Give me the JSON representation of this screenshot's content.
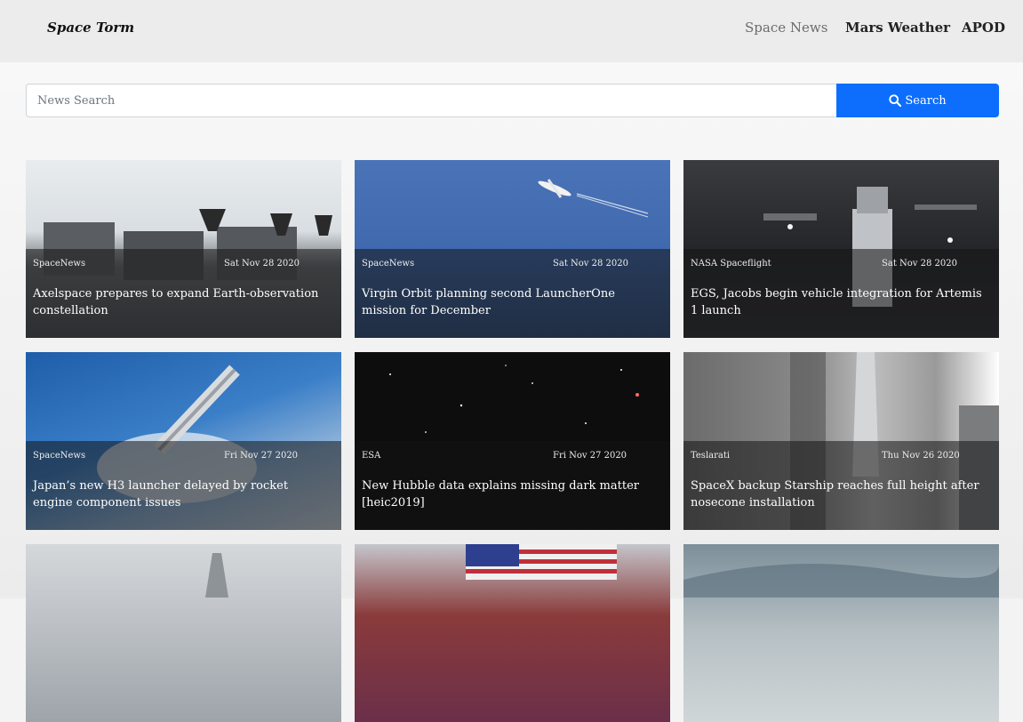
{
  "navbar": {
    "brand": "Space Torm",
    "links": [
      {
        "label": "Space News",
        "active": true
      },
      {
        "label": "Mars Weather",
        "active": false
      },
      {
        "label": "APOD",
        "active": false
      }
    ]
  },
  "search": {
    "placeholder": "News Search",
    "value": "",
    "button_label": "Search",
    "button_color": "#0d6efd"
  },
  "articles": [
    {
      "source": "SpaceNews",
      "date": "Sat Nov 28 2020",
      "title": "Axelspace prepares to expand Earth-observation constellation"
    },
    {
      "source": "SpaceNews",
      "date": "Sat Nov 28 2020",
      "title": "Virgin Orbit planning second LauncherOne mission for December"
    },
    {
      "source": "NASA Spaceflight",
      "date": "Sat Nov 28 2020",
      "title": "EGS, Jacobs begin vehicle integration for Artemis 1 launch"
    },
    {
      "source": "SpaceNews",
      "date": "Fri Nov 27 2020",
      "title": "Japan’s new H3 launcher delayed by rocket engine component issues"
    },
    {
      "source": "ESA",
      "date": "Fri Nov 27 2020",
      "title": "New Hubble data explains missing dark matter [heic2019]"
    },
    {
      "source": "Teslarati",
      "date": "Thu Nov 26 2020",
      "title": "SpaceX backup Starship reaches full height after nosecone installation"
    }
  ]
}
